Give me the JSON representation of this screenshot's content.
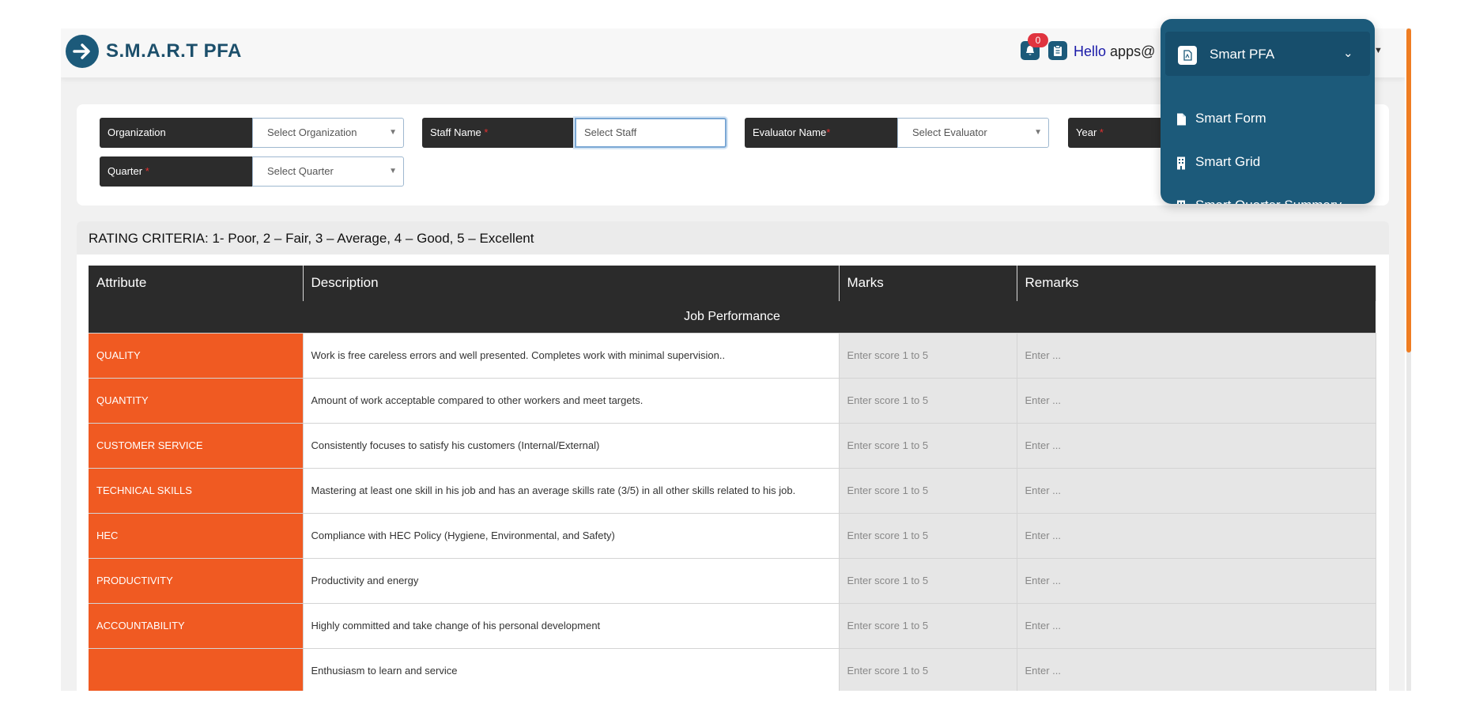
{
  "app": {
    "brand": "S.M.A.R.T PFA"
  },
  "header": {
    "notification_count": "0",
    "greeting": "Hello",
    "user": "apps@"
  },
  "filters": {
    "organization": {
      "label": "Organization",
      "placeholder": "Select Organization"
    },
    "staff": {
      "label": "Staff Name",
      "placeholder": "Select Staff"
    },
    "evaluator": {
      "label": "Evaluator Name",
      "placeholder": "Select Evaluator"
    },
    "year": {
      "label": "Year"
    },
    "quarter": {
      "label": "Quarter",
      "placeholder": "Select Quarter"
    },
    "required_mark": "*"
  },
  "rating": {
    "title": "RATING CRITERIA: 1- Poor, 2 – Fair, 3 – Average, 4 – Good, 5 – Excellent",
    "columns": [
      "Attribute",
      "Description",
      "Marks",
      "Remarks"
    ],
    "section": "Job Performance",
    "marks_placeholder": "Enter score 1 to 5",
    "remarks_placeholder": "Enter ...",
    "rows": [
      {
        "attribute": "QUALITY",
        "description": "Work is free careless errors and well presented. Completes work with minimal supervision.."
      },
      {
        "attribute": "QUANTITY",
        "description": "Amount of work acceptable compared to other workers and meet targets."
      },
      {
        "attribute": "CUSTOMER SERVICE",
        "description": "Consistently focuses to satisfy his customers (Internal/External)"
      },
      {
        "attribute": "TECHNICAL SKILLS",
        "description": "Mastering at least one skill in his job and has an average skills rate (3/5) in all other skills related to his job."
      },
      {
        "attribute": "HEC",
        "description": "Compliance with HEC Policy (Hygiene, Environmental, and Safety)"
      },
      {
        "attribute": "PRODUCTIVITY",
        "description": "Productivity and energy"
      },
      {
        "attribute": "ACCOUNTABILITY",
        "description": "Highly committed and take change of his personal development"
      },
      {
        "attribute": "",
        "description": "Enthusiasm to learn and service"
      }
    ]
  },
  "menu": {
    "header": "Smart PFA",
    "items": [
      "Smart Form",
      "Smart Grid",
      "Smart Quarter Summary"
    ]
  },
  "colors": {
    "primary": "#1c5a7a",
    "accent": "#f05a22",
    "dark": "#2b2b2b",
    "scroll": "#ef7d22"
  }
}
